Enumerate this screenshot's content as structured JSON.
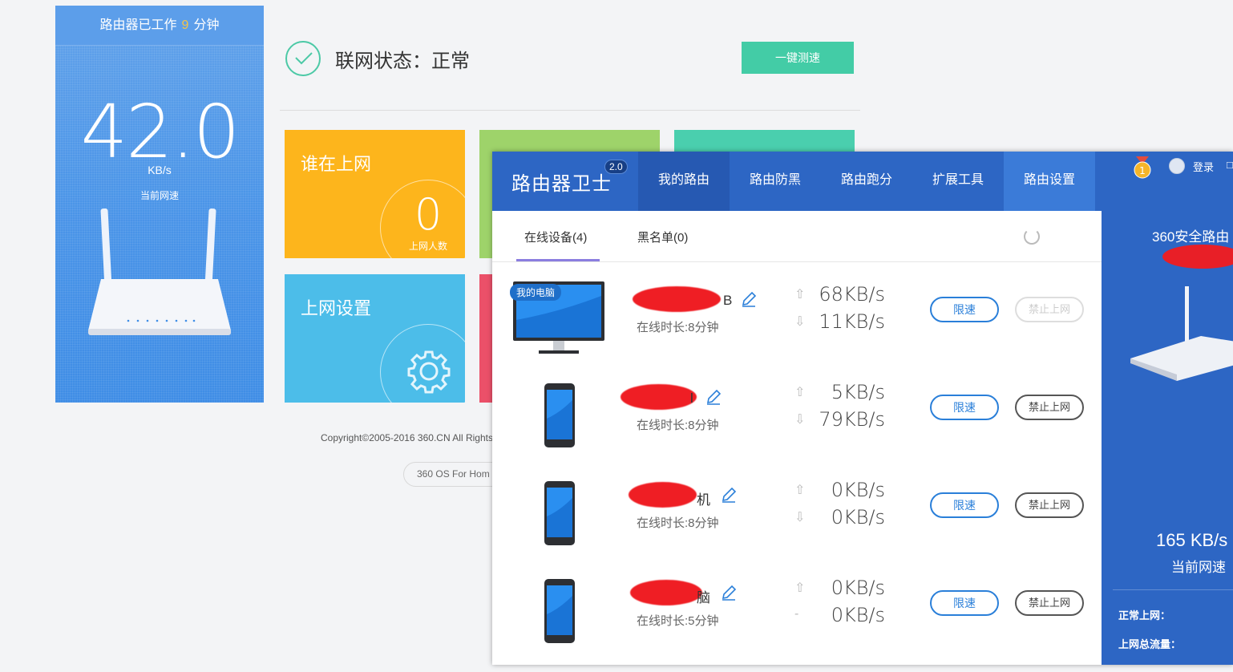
{
  "bg": {
    "uptime_prefix": "路由器已工作",
    "uptime_value": "9",
    "uptime_suffix": "分钟",
    "speed_value": "42.0",
    "speed_unit": "KB/s",
    "speed_label": "当前网速",
    "status_text": "联网状态：正常",
    "speedtest_label": "一键测速",
    "tile_who_title": "谁在上网",
    "tile_who_count": "0",
    "tile_who_count_label": "上网人数",
    "tile_net_title": "上网设置",
    "copyright": "Copyright©2005-2016 360.CN All Rights",
    "os_label": "360 OS For Hom"
  },
  "app": {
    "brand": "路由器卫士",
    "version": "2.0",
    "nav": [
      "我的路由",
      "路由防黑",
      "路由跑分",
      "扩展工具",
      "路由设置"
    ],
    "login": "登录",
    "more": "□",
    "tabs": {
      "online": "在线设备(4)",
      "blacklist": "黑名单(0)"
    },
    "pc_tag": "我的电脑",
    "limit_label": "限速",
    "block_label": "禁止上网",
    "devices": [
      {
        "tail": "B",
        "duration": "在线时长:8分钟",
        "up": "68KB/s",
        "down": "11KB/s",
        "up_arrow": "⇧",
        "down_arrow": "⇩"
      },
      {
        "tail": "l",
        "duration": "在线时长:8分钟",
        "up": "5KB/s",
        "down": "79KB/s",
        "up_arrow": "⇧",
        "down_arrow": "⇩"
      },
      {
        "tail": "机",
        "duration": "在线时长:8分钟",
        "up": "0KB/s",
        "down": "0KB/s",
        "up_arrow": "⇧",
        "down_arrow": "⇩"
      },
      {
        "tail": "脑",
        "duration": "在线时长:5分钟",
        "up": "0KB/s",
        "down": "0KB/s",
        "up_arrow": "⇧",
        "down_arrow": "-"
      }
    ],
    "side": {
      "title": "360安全路由",
      "speed": "165 KB/s",
      "speed_label": "当前网速",
      "stat_normal": "正常上网：",
      "stat_total": "上网总流量："
    }
  },
  "colors": {
    "accent_blue": "#2d66c4",
    "tile_yellow": "#fdb51c",
    "tile_green": "#9ed36a",
    "tile_teal": "#4acfae",
    "tile_lightblue": "#4cbde9",
    "tile_red": "#eb5069"
  }
}
